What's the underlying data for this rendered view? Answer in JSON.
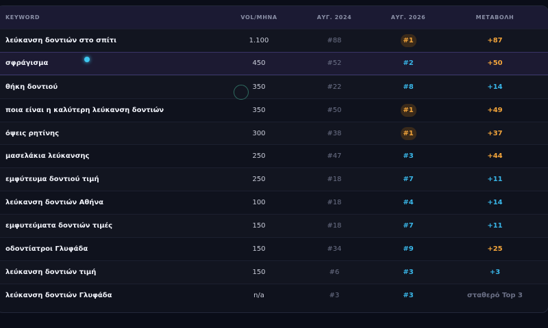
{
  "table": {
    "headers": {
      "keyword": "KEYWORD",
      "volume": "VOL/ΜΗΝΑ",
      "aug2024": "ΑΥΓ. 2024",
      "aug2026": "ΑΥΓ. 2026",
      "change": "ΜΕΤΑΒΟΛΗ"
    },
    "rows": [
      {
        "keyword": "λεύκανση δοντιών στο σπίτι",
        "volume": "1.100",
        "aug2024": "#88",
        "aug2026": "#1",
        "change": "+87",
        "top": true,
        "change_color": "orange"
      },
      {
        "keyword": "σφράγισμα",
        "volume": "450",
        "aug2024": "#52",
        "aug2026": "#2",
        "change": "+50",
        "top": false,
        "change_color": "orange"
      },
      {
        "keyword": "θήκη δοντιού",
        "volume": "350",
        "aug2024": "#22",
        "aug2026": "#8",
        "change": "+14",
        "top": false,
        "change_color": "blue"
      },
      {
        "keyword": "ποια είναι η καλύτερη λεύκανση δοντιών",
        "volume": "350",
        "aug2024": "#50",
        "aug2026": "#1",
        "change": "+49",
        "top": true,
        "change_color": "orange"
      },
      {
        "keyword": "όψεις ρητίνης",
        "volume": "300",
        "aug2024": "#38",
        "aug2026": "#1",
        "change": "+37",
        "top": true,
        "change_color": "orange"
      },
      {
        "keyword": "μασελάκια λεύκανσης",
        "volume": "250",
        "aug2024": "#47",
        "aug2026": "#3",
        "change": "+44",
        "top": false,
        "change_color": "orange"
      },
      {
        "keyword": "εμφύτευμα δοντιού τιμή",
        "volume": "250",
        "aug2024": "#18",
        "aug2026": "#7",
        "change": "+11",
        "top": false,
        "change_color": "blue"
      },
      {
        "keyword": "λεύκανση δοντιών Αθήνα",
        "volume": "100",
        "aug2024": "#18",
        "aug2026": "#4",
        "change": "+14",
        "top": false,
        "change_color": "blue"
      },
      {
        "keyword": "εμφυτεύματα δοντιών τιμές",
        "volume": "150",
        "aug2024": "#18",
        "aug2026": "#7",
        "change": "+11",
        "top": false,
        "change_color": "blue"
      },
      {
        "keyword": "οδοντίατροι Γλυφάδα",
        "volume": "150",
        "aug2024": "#34",
        "aug2026": "#9",
        "change": "+25",
        "top": false,
        "change_color": "orange"
      },
      {
        "keyword": "λεύκανση δοντιών τιμή",
        "volume": "150",
        "aug2024": "#6",
        "aug2026": "#3",
        "change": "+3",
        "top": false,
        "change_color": "blue"
      },
      {
        "keyword": "λεύκανση δοντιών Γλυφάδα",
        "volume": "n/a",
        "aug2024": "#3",
        "aug2026": "#3",
        "change": "σταθερό Top 3",
        "top": false,
        "change_color": "muted"
      }
    ]
  },
  "colors": {
    "accent_orange": "#f3a53b",
    "accent_blue": "#39b6e8",
    "header_bg": "#1b1a33",
    "page_bg": "#0a0d18"
  }
}
